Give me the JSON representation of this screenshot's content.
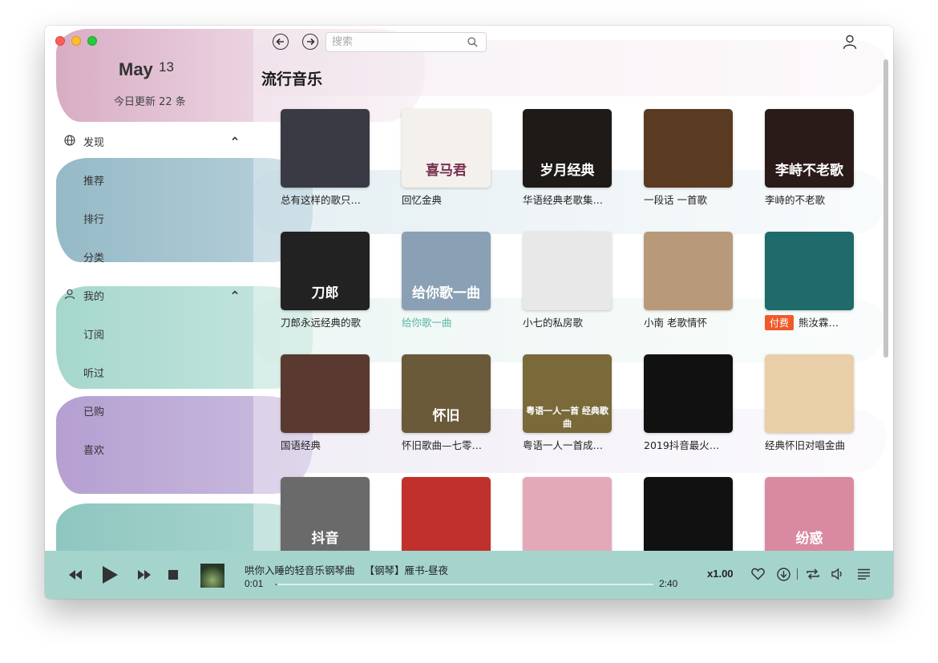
{
  "window": {
    "traffic_lights": [
      "close",
      "minimize",
      "zoom"
    ]
  },
  "header": {
    "month": "May",
    "day": "13",
    "today_update": "今日更新 22 条"
  },
  "sidebar": {
    "sections": [
      {
        "label": "发现",
        "icon": "globe-icon",
        "items": [
          "推荐",
          "排行",
          "分类"
        ]
      },
      {
        "label": "我的",
        "icon": "user-icon",
        "items": [
          "订阅",
          "听过",
          "已购",
          "喜欢"
        ]
      }
    ]
  },
  "toolbar": {
    "search_placeholder": "搜索"
  },
  "main": {
    "title": "流行音乐",
    "albums": [
      {
        "title": "总有这样的歌只…",
        "cover_color": "#3a3a44"
      },
      {
        "title": "回忆金典",
        "cover_text": "喜马君",
        "cover_color": "#f4f0ec"
      },
      {
        "title": "华语经典老歌集…",
        "cover_text": "岁月经典",
        "cover_color": "#1e1a18"
      },
      {
        "title": "一段话 一首歌",
        "cover_color": "#5a3a20"
      },
      {
        "title": "李峙的不老歌",
        "cover_text": "李峙不老歌",
        "cover_color": "#2a1a18"
      },
      {
        "title": "刀郎永远经典的歌",
        "cover_text": "刀郎",
        "cover_color": "#222222"
      },
      {
        "title": "给你歌一曲",
        "cover_text": "给你歌一曲",
        "cover_color": "#8aa0b4",
        "highlight": true
      },
      {
        "title": "小七的私房歌",
        "cover_color": "#e8e8e8"
      },
      {
        "title": "小南 老歌情怀",
        "cover_color": "#b89a7a"
      },
      {
        "title": "熊汝霖…",
        "badge": "付费",
        "cover_color": "#1f6a6a"
      },
      {
        "title": "国语经典",
        "cover_color": "#5a3a30"
      },
      {
        "title": "怀旧歌曲—七零…",
        "cover_text": "怀旧",
        "cover_color": "#6a5a3a"
      },
      {
        "title": "粤语一人一首成…",
        "cover_text": "粤语一人一首 经典歌曲",
        "cover_color": "#7a6a3a"
      },
      {
        "title": "2019抖音最火…",
        "cover_color": "#111111"
      },
      {
        "title": "经典怀旧对唱金曲",
        "cover_color": "#e8cfa8"
      },
      {
        "title": "",
        "cover_text": "抖音",
        "cover_color": "#6a6a6a"
      },
      {
        "title": "",
        "cover_color": "#c0302c"
      },
      {
        "title": "",
        "cover_color": "#e3a9b8"
      },
      {
        "title": "",
        "cover_color": "#111111"
      },
      {
        "title": "",
        "cover_text": "纷惑",
        "cover_color": "#d98aa0"
      }
    ]
  },
  "player": {
    "track": "哄你入睡的轻音乐钢琴曲",
    "subtitle": "【钢琴】雁书-昼夜",
    "current_time": "0:01",
    "total_time": "2:40",
    "progress": 0.006,
    "speed": "x1.00",
    "colors": {
      "bar": "#a5d4cd",
      "badge": "#f05a2a",
      "highlight": "#5bb6a4"
    }
  }
}
